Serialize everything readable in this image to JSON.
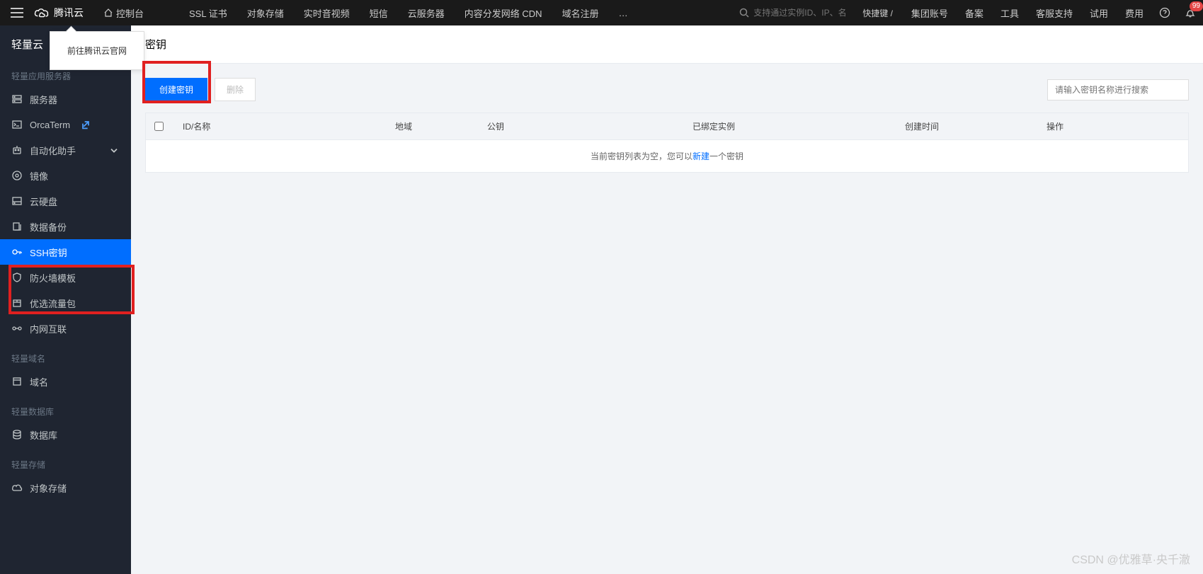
{
  "header": {
    "brand": "腾讯云",
    "console": "控制台",
    "nav": [
      "SSL 证书",
      "对象存储",
      "实时音视频",
      "短信",
      "云服务器",
      "内容分发网络 CDN",
      "域名注册",
      "…"
    ],
    "search_placeholder": "支持通过实例ID、IP、名",
    "hotkey": "快捷键 /",
    "right": [
      "集团账号",
      "备案",
      "工具",
      "客服支持",
      "试用",
      "费用"
    ],
    "badge": "99"
  },
  "tooltip": "前往腾讯云官网",
  "sidebar": {
    "title": "轻量云",
    "sections": [
      {
        "label": "轻量应用服务器",
        "items": [
          {
            "label": "服务器",
            "icon": "server"
          },
          {
            "label": "OrcaTerm",
            "icon": "terminal",
            "external": true
          },
          {
            "label": "自动化助手",
            "icon": "robot",
            "expandable": true
          },
          {
            "label": "镜像",
            "icon": "disc"
          },
          {
            "label": "云硬盘",
            "icon": "hdd"
          },
          {
            "label": "数据备份",
            "icon": "backup"
          },
          {
            "label": "SSH密钥",
            "icon": "key",
            "active": true
          },
          {
            "label": "防火墙模板",
            "icon": "firewall"
          },
          {
            "label": "优选流量包",
            "icon": "package"
          },
          {
            "label": "内网互联",
            "icon": "network"
          }
        ]
      },
      {
        "label": "轻量域名",
        "items": [
          {
            "label": "域名",
            "icon": "globe"
          }
        ]
      },
      {
        "label": "轻量数据库",
        "items": [
          {
            "label": "数据库",
            "icon": "database"
          }
        ]
      },
      {
        "label": "轻量存储",
        "items": [
          {
            "label": "对象存储",
            "icon": "storage"
          }
        ]
      }
    ]
  },
  "page": {
    "title": "密钥",
    "create_btn": "创建密钥",
    "delete_btn": "删除",
    "search_placeholder": "请输入密钥名称进行搜索",
    "columns": {
      "id": "ID/名称",
      "region": "地域",
      "pubkey": "公钥",
      "bound": "已绑定实例",
      "time": "创建时间",
      "op": "操作"
    },
    "empty_prefix": "当前密钥列表为空，您可以",
    "empty_link": "新建",
    "empty_suffix": "一个密钥"
  },
  "watermark": "CSDN @优雅草·央千澈"
}
